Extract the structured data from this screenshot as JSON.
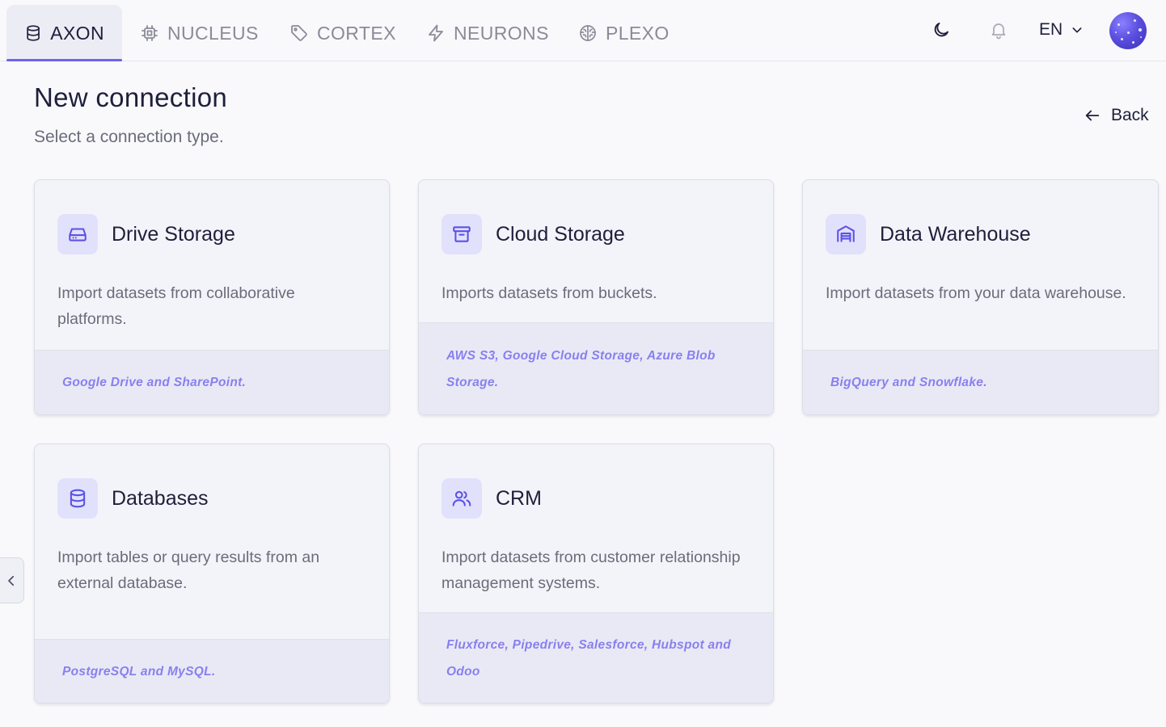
{
  "nav": {
    "tabs": [
      {
        "label": "AXON",
        "icon": "database-icon",
        "active": true
      },
      {
        "label": "NUCLEUS",
        "icon": "cpu-chip-icon",
        "active": false
      },
      {
        "label": "CORTEX",
        "icon": "tag-icon",
        "active": false
      },
      {
        "label": "NEURONS",
        "icon": "lightning-bolt-icon",
        "active": false
      },
      {
        "label": "PLEXO",
        "icon": "brain-icon",
        "active": false
      }
    ],
    "theme_icon": "moon-icon",
    "notifications_icon": "bell-icon",
    "language": "EN"
  },
  "header": {
    "title": "New connection",
    "subtitle": "Select a connection type.",
    "back_label": "Back"
  },
  "cards": [
    {
      "title": "Drive Storage",
      "icon": "drive-icon",
      "description": "Import datasets from collaborative platforms.",
      "providers": "Google Drive and SharePoint."
    },
    {
      "title": "Cloud Storage",
      "icon": "archive-box-icon",
      "description": "Imports datasets from buckets.",
      "providers": "AWS S3, Google Cloud Storage, Azure Blob Storage."
    },
    {
      "title": "Data Warehouse",
      "icon": "warehouse-icon",
      "description": "Import datasets from your data warehouse.",
      "providers": "BigQuery and Snowflake."
    },
    {
      "title": "Databases",
      "icon": "database-icon",
      "description": "Import tables or query results from an external database.",
      "providers": "PostgreSQL and MySQL."
    },
    {
      "title": "CRM",
      "icon": "users-icon",
      "description": "Import datasets from customer relationship management systems.",
      "providers": "Fluxforce, Pipedrive, Salesforce, Hubspot and Odoo"
    }
  ],
  "colors": {
    "accent": "#6c63f0",
    "icon_bg": "#e2e1fb",
    "provider_text": "#8880ee",
    "footer_bg": "#e9e9f6"
  }
}
